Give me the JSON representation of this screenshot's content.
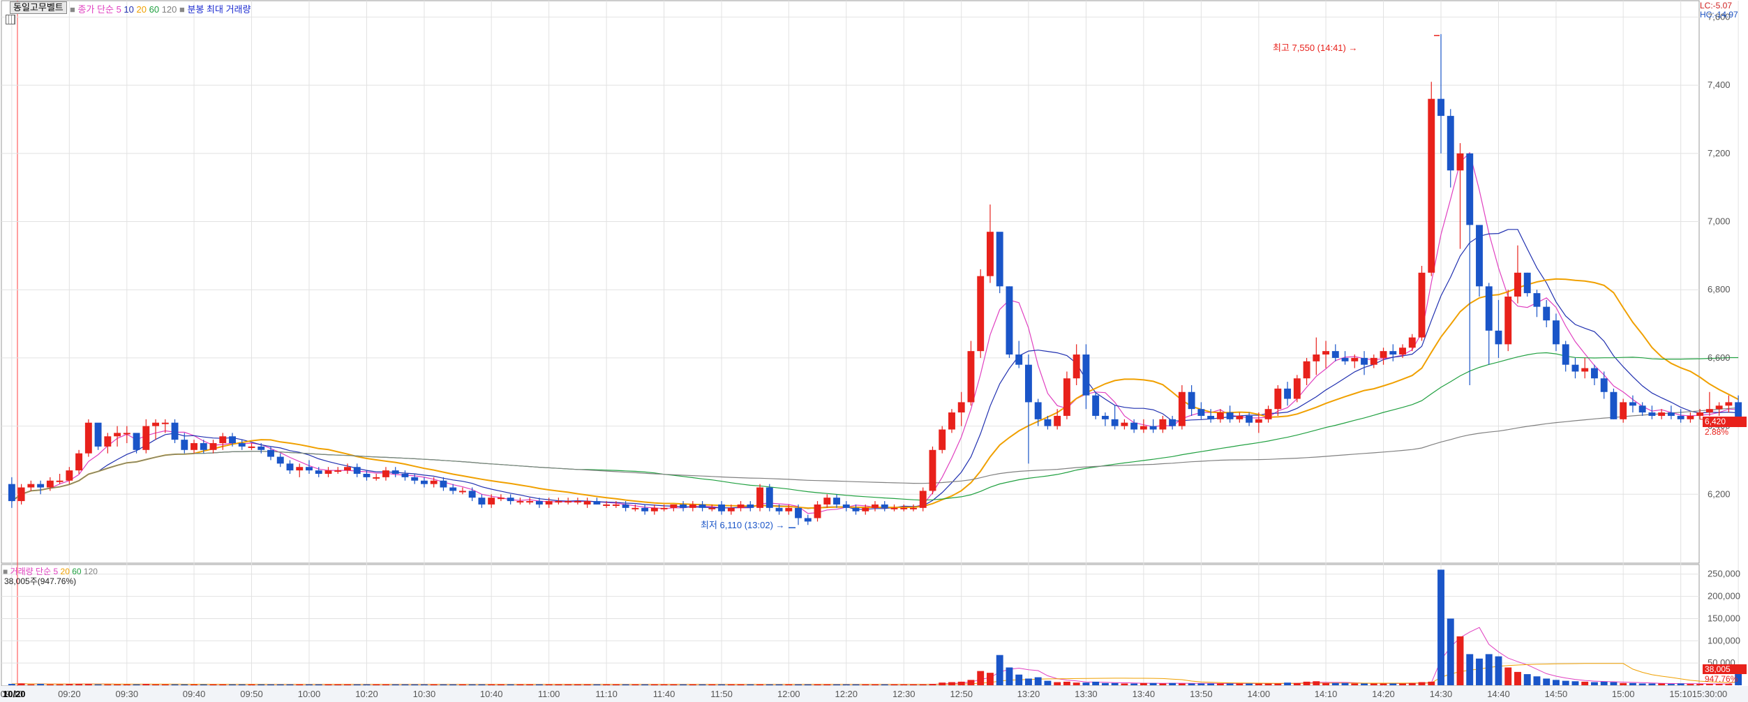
{
  "stock_name": "동일고무벨트",
  "price_legend": {
    "marker": "■",
    "label": "종가 단순",
    "periods": [
      "5",
      "10",
      "20",
      "60",
      "120"
    ],
    "candle_label": "분봉 최대 거래량"
  },
  "volume_legend": {
    "marker": "■",
    "label": "거래량 단순",
    "periods": [
      "5",
      "20",
      "60",
      "120"
    ],
    "readout": "38,005주(947.76%)"
  },
  "corner_readout": {
    "lc": "LC:-5.07",
    "hc": "HC:-14.97"
  },
  "current_price": {
    "value": "6,420",
    "pct": "2.88%",
    "price": 6420
  },
  "current_volume": {
    "value": "38,005",
    "pct": "947.76%",
    "volume": 38005
  },
  "high_annotation": {
    "text": "최고 7,550 (14:41) →",
    "price": 7550,
    "time": "14:41"
  },
  "low_annotation": {
    "text": "최저 6,110 (13:02) →",
    "price": 6110,
    "time": "13:02"
  },
  "date_label": "10/20",
  "colors": {
    "up": "#e8211b",
    "down": "#1a55c8",
    "ma5": "#e040c0",
    "ma10": "#2030b0",
    "ma20": "#f0a000",
    "ma60": "#20a040",
    "ma120": "#808080",
    "grid": "#e2e2e2"
  },
  "chart_data": [
    {
      "type": "candlestick",
      "title": "동일고무벨트",
      "ylim": [
        6000,
        7650
      ],
      "yticks": [
        "7,600",
        "7,400",
        "7,200",
        "7,000",
        "6,800",
        "6,600",
        "6,400",
        "6,200"
      ],
      "xticks": [
        "09:10",
        "09:20",
        "09:30",
        "09:40",
        "09:50",
        "10:00",
        "10:20",
        "10:30",
        "10:40",
        "11:00",
        "11:10",
        "11:40",
        "11:50",
        "12:00",
        "12:20",
        "12:30",
        "12:50",
        "13:20",
        "13:30",
        "13:40",
        "13:50",
        "14:00",
        "14:10",
        "14:20",
        "14:30",
        "14:40",
        "14:50",
        "15:00",
        "15:10",
        "15:30:00"
      ],
      "candles": [
        [
          6230,
          6250,
          6160,
          6180
        ],
        [
          6180,
          6230,
          6170,
          6220
        ],
        [
          6220,
          6240,
          6210,
          6230
        ],
        [
          6230,
          6240,
          6200,
          6220
        ],
        [
          6220,
          6250,
          6210,
          6240
        ],
        [
          6240,
          6260,
          6230,
          6240
        ],
        [
          6240,
          6280,
          6230,
          6270
        ],
        [
          6270,
          6330,
          6260,
          6320
        ],
        [
          6320,
          6420,
          6310,
          6410
        ],
        [
          6410,
          6400,
          6330,
          6340
        ],
        [
          6340,
          6380,
          6320,
          6370
        ],
        [
          6370,
          6400,
          6340,
          6380
        ],
        [
          6380,
          6400,
          6350,
          6380
        ],
        [
          6380,
          6370,
          6320,
          6330
        ],
        [
          6330,
          6420,
          6320,
          6400
        ],
        [
          6400,
          6420,
          6360,
          6410
        ],
        [
          6410,
          6420,
          6380,
          6410
        ],
        [
          6410,
          6420,
          6350,
          6360
        ],
        [
          6360,
          6380,
          6320,
          6330
        ],
        [
          6330,
          6360,
          6320,
          6350
        ],
        [
          6350,
          6360,
          6320,
          6330
        ],
        [
          6330,
          6360,
          6320,
          6350
        ],
        [
          6350,
          6380,
          6330,
          6370
        ],
        [
          6370,
          6380,
          6340,
          6350
        ],
        [
          6350,
          6360,
          6330,
          6340
        ],
        [
          6340,
          6350,
          6330,
          6340
        ],
        [
          6340,
          6350,
          6320,
          6330
        ],
        [
          6330,
          6340,
          6300,
          6310
        ],
        [
          6310,
          6320,
          6280,
          6290
        ],
        [
          6290,
          6300,
          6260,
          6270
        ],
        [
          6270,
          6290,
          6250,
          6280
        ],
        [
          6280,
          6300,
          6260,
          6270
        ],
        [
          6270,
          6280,
          6250,
          6260
        ],
        [
          6260,
          6280,
          6250,
          6270
        ],
        [
          6270,
          6280,
          6260,
          6270
        ],
        [
          6270,
          6290,
          6260,
          6280
        ],
        [
          6280,
          6290,
          6250,
          6260
        ],
        [
          6260,
          6270,
          6240,
          6250
        ],
        [
          6250,
          6260,
          6240,
          6250
        ],
        [
          6250,
          6280,
          6240,
          6270
        ],
        [
          6270,
          6280,
          6250,
          6260
        ],
        [
          6260,
          6270,
          6240,
          6250
        ],
        [
          6250,
          6260,
          6230,
          6240
        ],
        [
          6240,
          6250,
          6220,
          6230
        ],
        [
          6230,
          6250,
          6220,
          6240
        ],
        [
          6240,
          6250,
          6210,
          6220
        ],
        [
          6220,
          6230,
          6200,
          6210
        ],
        [
          6210,
          6220,
          6200,
          6210
        ],
        [
          6210,
          6220,
          6180,
          6190
        ],
        [
          6190,
          6200,
          6160,
          6170
        ],
        [
          6170,
          6200,
          6160,
          6190
        ],
        [
          6190,
          6200,
          6180,
          6190
        ],
        [
          6190,
          6200,
          6170,
          6180
        ],
        [
          6180,
          6190,
          6170,
          6180
        ],
        [
          6180,
          6190,
          6170,
          6180
        ],
        [
          6180,
          6190,
          6160,
          6170
        ],
        [
          6170,
          6190,
          6160,
          6180
        ],
        [
          6180,
          6190,
          6170,
          6180
        ],
        [
          6180,
          6190,
          6170,
          6180
        ],
        [
          6180,
          6190,
          6170,
          6180
        ],
        [
          6170,
          6190,
          6160,
          6180
        ],
        [
          6180,
          6190,
          6170,
          6170
        ],
        [
          6170,
          6180,
          6160,
          6170
        ],
        [
          6170,
          6180,
          6160,
          6170
        ],
        [
          6170,
          6180,
          6150,
          6160
        ],
        [
          6160,
          6170,
          6150,
          6160
        ],
        [
          6160,
          6170,
          6140,
          6150
        ],
        [
          6150,
          6170,
          6140,
          6160
        ],
        [
          6160,
          6170,
          6150,
          6160
        ],
        [
          6160,
          6170,
          6150,
          6170
        ],
        [
          6170,
          6180,
          6150,
          6160
        ],
        [
          6160,
          6180,
          6150,
          6170
        ],
        [
          6170,
          6180,
          6150,
          6160
        ],
        [
          6160,
          6170,
          6150,
          6160
        ],
        [
          6170,
          6180,
          6140,
          6150
        ],
        [
          6150,
          6170,
          6140,
          6160
        ],
        [
          6160,
          6180,
          6150,
          6170
        ],
        [
          6170,
          6180,
          6150,
          6160
        ],
        [
          6160,
          6230,
          6150,
          6220
        ],
        [
          6220,
          6230,
          6150,
          6160
        ],
        [
          6160,
          6170,
          6140,
          6150
        ],
        [
          6150,
          6170,
          6140,
          6160
        ],
        [
          6160,
          6170,
          6110,
          6130
        ],
        [
          6130,
          6140,
          6110,
          6120
        ],
        [
          6130,
          6180,
          6120,
          6170
        ],
        [
          6170,
          6200,
          6160,
          6190
        ],
        [
          6190,
          6200,
          6160,
          6170
        ],
        [
          6170,
          6180,
          6150,
          6160
        ],
        [
          6160,
          6170,
          6140,
          6150
        ],
        [
          6150,
          6170,
          6140,
          6160
        ],
        [
          6160,
          6180,
          6150,
          6170
        ],
        [
          6170,
          6180,
          6150,
          6160
        ],
        [
          6160,
          6170,
          6150,
          6160
        ],
        [
          6160,
          6170,
          6150,
          6160
        ],
        [
          6160,
          6170,
          6150,
          6160
        ],
        [
          6160,
          6220,
          6150,
          6210
        ],
        [
          6210,
          6340,
          6200,
          6330
        ],
        [
          6330,
          6400,
          6320,
          6390
        ],
        [
          6390,
          6450,
          6380,
          6440
        ],
        [
          6440,
          6500,
          6400,
          6470
        ],
        [
          6470,
          6650,
          6460,
          6620
        ],
        [
          6620,
          6860,
          6600,
          6840
        ],
        [
          6840,
          7050,
          6820,
          6970
        ],
        [
          6970,
          6950,
          6790,
          6810
        ],
        [
          6810,
          6810,
          6600,
          6610
        ],
        [
          6610,
          6650,
          6570,
          6580
        ],
        [
          6580,
          6610,
          6290,
          6470
        ],
        [
          6470,
          6480,
          6400,
          6420
        ],
        [
          6420,
          6430,
          6390,
          6400
        ],
        [
          6400,
          6450,
          6390,
          6430
        ],
        [
          6430,
          6560,
          6420,
          6540
        ],
        [
          6540,
          6640,
          6520,
          6610
        ],
        [
          6610,
          6640,
          6450,
          6490
        ],
        [
          6490,
          6500,
          6420,
          6430
        ],
        [
          6430,
          6440,
          6400,
          6420
        ],
        [
          6420,
          6460,
          6390,
          6400
        ],
        [
          6400,
          6420,
          6390,
          6410
        ],
        [
          6410,
          6420,
          6380,
          6390
        ],
        [
          6390,
          6420,
          6380,
          6400
        ],
        [
          6400,
          6420,
          6380,
          6390
        ],
        [
          6390,
          6430,
          6380,
          6420
        ],
        [
          6420,
          6430,
          6390,
          6400
        ],
        [
          6400,
          6520,
          6390,
          6500
        ],
        [
          6500,
          6520,
          6430,
          6450
        ],
        [
          6450,
          6470,
          6420,
          6430
        ],
        [
          6430,
          6450,
          6410,
          6420
        ],
        [
          6420,
          6450,
          6410,
          6440
        ],
        [
          6440,
          6460,
          6410,
          6420
        ],
        [
          6420,
          6440,
          6410,
          6430
        ],
        [
          6430,
          6440,
          6400,
          6410
        ],
        [
          6410,
          6440,
          6380,
          6420
        ],
        [
          6420,
          6460,
          6410,
          6450
        ],
        [
          6450,
          6520,
          6430,
          6510
        ],
        [
          6510,
          6530,
          6460,
          6480
        ],
        [
          6480,
          6550,
          6470,
          6540
        ],
        [
          6540,
          6600,
          6520,
          6590
        ],
        [
          6590,
          6660,
          6550,
          6610
        ],
        [
          6610,
          6650,
          6570,
          6620
        ],
        [
          6620,
          6640,
          6590,
          6600
        ],
        [
          6600,
          6620,
          6580,
          6590
        ],
        [
          6590,
          6610,
          6570,
          6600
        ],
        [
          6600,
          6620,
          6550,
          6580
        ],
        [
          6580,
          6610,
          6570,
          6600
        ],
        [
          6600,
          6630,
          6580,
          6620
        ],
        [
          6620,
          6640,
          6590,
          6610
        ],
        [
          6610,
          6640,
          6600,
          6630
        ],
        [
          6630,
          6670,
          6620,
          6660
        ],
        [
          6660,
          6870,
          6650,
          6850
        ],
        [
          6850,
          7410,
          6840,
          7360
        ],
        [
          7360,
          7550,
          7200,
          7310
        ],
        [
          7310,
          7330,
          7100,
          7150
        ],
        [
          7150,
          7230,
          6920,
          7200
        ],
        [
          7200,
          7180,
          6520,
          6990
        ],
        [
          6990,
          6840,
          6780,
          6810
        ],
        [
          6810,
          6820,
          6580,
          6680
        ],
        [
          6680,
          6770,
          6600,
          6640
        ],
        [
          6640,
          6800,
          6620,
          6780
        ],
        [
          6780,
          6930,
          6760,
          6850
        ],
        [
          6850,
          6850,
          6780,
          6790
        ],
        [
          6790,
          6800,
          6720,
          6750
        ],
        [
          6750,
          6770,
          6690,
          6710
        ],
        [
          6710,
          6730,
          6620,
          6640
        ],
        [
          6640,
          6650,
          6560,
          6580
        ],
        [
          6580,
          6600,
          6540,
          6560
        ],
        [
          6560,
          6600,
          6540,
          6570
        ],
        [
          6570,
          6580,
          6520,
          6540
        ],
        [
          6540,
          6560,
          6480,
          6500
        ],
        [
          6500,
          6510,
          6420,
          6420
        ],
        [
          6420,
          6480,
          6410,
          6470
        ],
        [
          6470,
          6490,
          6440,
          6460
        ],
        [
          6460,
          6470,
          6430,
          6440
        ],
        [
          6440,
          6460,
          6420,
          6430
        ],
        [
          6430,
          6450,
          6420,
          6440
        ],
        [
          6440,
          6460,
          6420,
          6430
        ],
        [
          6430,
          6450,
          6410,
          6420
        ],
        [
          6420,
          6440,
          6410,
          6430
        ],
        [
          6430,
          6450,
          6420,
          6440
        ],
        [
          6440,
          6500,
          6430,
          6450
        ],
        [
          6450,
          6470,
          6430,
          6460
        ],
        [
          6460,
          6490,
          6440,
          6470
        ],
        [
          6470,
          6490,
          6430,
          6420
        ]
      ]
    },
    {
      "type": "bar",
      "title": "거래량",
      "ylim": [
        0,
        270000
      ],
      "yticks": [
        "250,000",
        "200,000",
        "150,000",
        "100,000",
        "50,000"
      ],
      "volumes": [
        3000,
        4000,
        2000,
        3000,
        2000,
        2000,
        3000,
        3000,
        3000,
        2000,
        2000,
        2000,
        2000,
        2000,
        3000,
        2000,
        2000,
        2000,
        2000,
        2000,
        2000,
        2000,
        2000,
        2000,
        2000,
        2000,
        2000,
        2000,
        2000,
        2000,
        2000,
        2000,
        2000,
        2000,
        2000,
        2000,
        2000,
        2000,
        2000,
        2000,
        2000,
        2000,
        2000,
        2000,
        2000,
        2000,
        2000,
        2000,
        2000,
        2000,
        2000,
        2000,
        2000,
        2000,
        2000,
        2000,
        2000,
        2000,
        2000,
        2000,
        2000,
        2000,
        2000,
        2000,
        2000,
        2000,
        2000,
        2000,
        2000,
        2000,
        2000,
        2000,
        2000,
        2000,
        2000,
        2000,
        2000,
        2000,
        2000,
        2000,
        2000,
        2000,
        2000,
        2000,
        2000,
        2000,
        2000,
        2000,
        2000,
        2000,
        2000,
        2000,
        2000,
        2000,
        2000,
        2000,
        3000,
        6000,
        7000,
        8000,
        12000,
        32000,
        28000,
        68000,
        40000,
        24000,
        15000,
        18000,
        10000,
        7000,
        8000,
        6000,
        6000,
        8000,
        5000,
        5000,
        4000,
        4000,
        5000,
        5000,
        4000,
        5000,
        4000,
        4000,
        4000,
        4000,
        4000,
        4000,
        4000,
        4000,
        4000,
        4000,
        4000,
        6000,
        5000,
        8000,
        9000,
        5000,
        5000,
        5000,
        4000,
        4000,
        4000,
        4000,
        4000,
        4000,
        5000,
        7000,
        8000,
        260000,
        150000,
        110000,
        70000,
        60000,
        70000,
        65000,
        40000,
        30000,
        25000,
        20000,
        15000,
        12000,
        10000,
        9000,
        8000,
        7000,
        8000,
        7000,
        5000,
        5000,
        4000,
        4000,
        4000,
        3000,
        4000,
        3000,
        3000,
        3000,
        3000,
        3000,
        38005
      ]
    }
  ]
}
